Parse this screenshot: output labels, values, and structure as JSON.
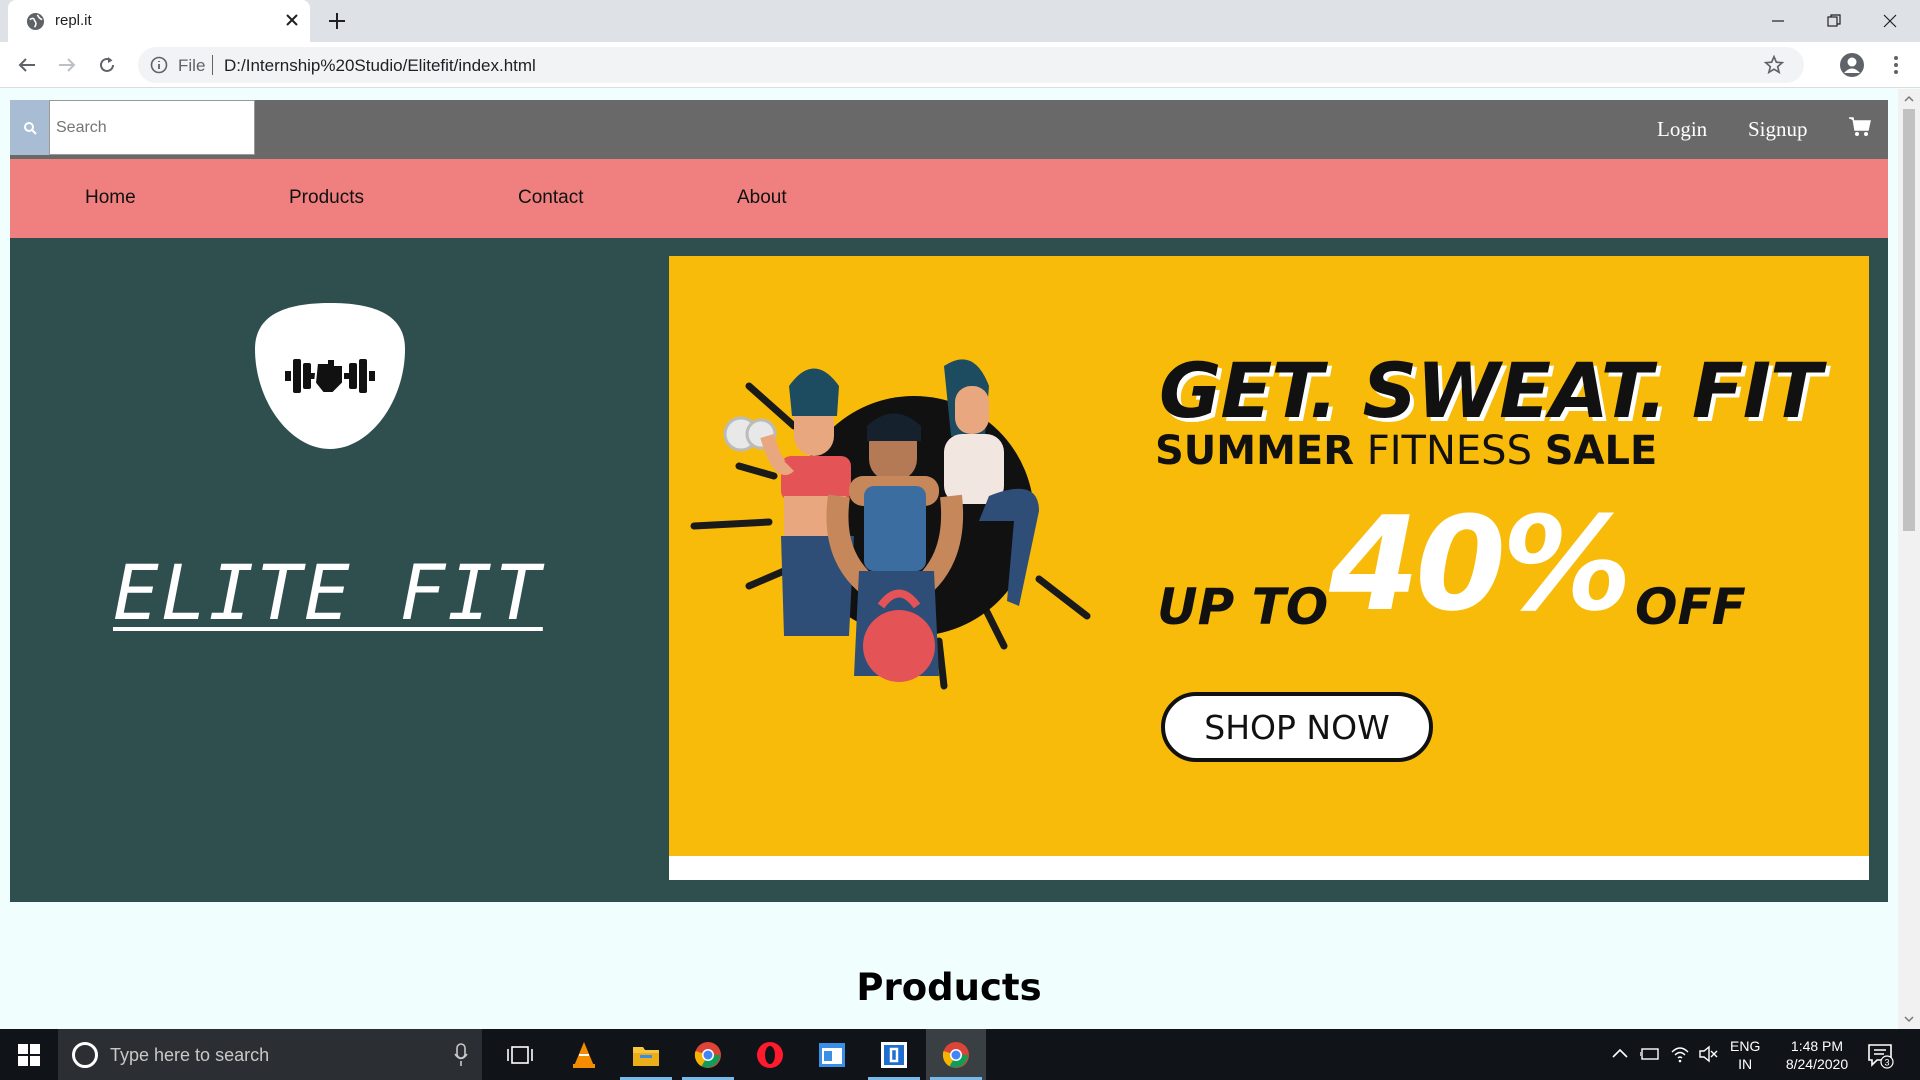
{
  "browser": {
    "tab_title": "repl.it",
    "new_tab_icon": "plus-icon",
    "address_prefix": "File",
    "address_url": "D:/Internship%20Studio/Elitefit/index.html"
  },
  "topbar": {
    "search_placeholder": "Search",
    "login_label": "Login",
    "signup_label": "Signup",
    "cart_icon": "cart-icon",
    "background": "#696969"
  },
  "nav": {
    "items": [
      "Home",
      "Products",
      "Contact",
      "About"
    ],
    "background": "#f08080"
  },
  "hero": {
    "brand": "ELITE FIT",
    "background": "#2f4f4f",
    "logo_icon": "dumbbell-icon",
    "banner": {
      "headline": "GET. SWEAT. FIT",
      "sub_1": "SUMMER",
      "sub_2": "FITNESS",
      "sub_3": "SALE",
      "up_to": "UP TO",
      "percent": "40%",
      "off": "OFF",
      "cta": "SHOP NOW",
      "background": "#f8bb0a"
    }
  },
  "section_heading": "Products",
  "taskbar": {
    "search_placeholder": "Type here to search",
    "lang_1": "ENG",
    "lang_2": "IN",
    "time": "1:48 PM",
    "date": "8/24/2020",
    "notification_count": "3"
  }
}
